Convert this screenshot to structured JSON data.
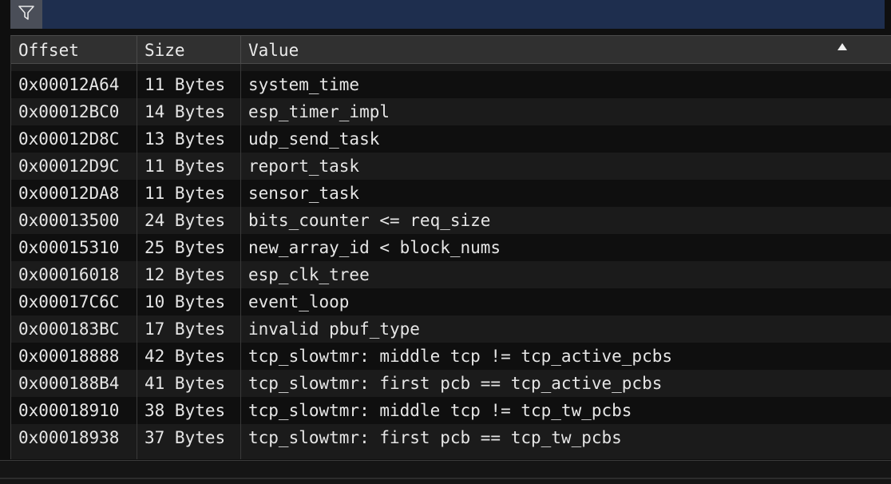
{
  "filter": {
    "icon": "filter-icon",
    "value": ""
  },
  "table": {
    "columns": [
      "Offset",
      "Size",
      "Value"
    ],
    "sort_indicator": "ascending",
    "rows": [
      {
        "offset": "0x00012A64",
        "size": "11 Bytes",
        "value": "system_time"
      },
      {
        "offset": "0x00012BC0",
        "size": "14 Bytes",
        "value": "esp_timer_impl"
      },
      {
        "offset": "0x00012D8C",
        "size": "13 Bytes",
        "value": "udp_send_task"
      },
      {
        "offset": "0x00012D9C",
        "size": "11 Bytes",
        "value": "report_task"
      },
      {
        "offset": "0x00012DA8",
        "size": "11 Bytes",
        "value": "sensor_task"
      },
      {
        "offset": "0x00013500",
        "size": "24 Bytes",
        "value": "bits_counter <= req_size"
      },
      {
        "offset": "0x00015310",
        "size": "25 Bytes",
        "value": "new_array_id < block_nums"
      },
      {
        "offset": "0x00016018",
        "size": "12 Bytes",
        "value": "esp_clk_tree"
      },
      {
        "offset": "0x00017C6C",
        "size": "10 Bytes",
        "value": "event_loop"
      },
      {
        "offset": "0x000183BC",
        "size": "17 Bytes",
        "value": "invalid pbuf_type"
      },
      {
        "offset": "0x00018888",
        "size": "42 Bytes",
        "value": "tcp_slowtmr: middle tcp != tcp_active_pcbs"
      },
      {
        "offset": "0x000188B4",
        "size": "41 Bytes",
        "value": "tcp_slowtmr: first pcb == tcp_active_pcbs"
      },
      {
        "offset": "0x00018910",
        "size": "38 Bytes",
        "value": "tcp_slowtmr: middle tcp != tcp_tw_pcbs"
      },
      {
        "offset": "0x00018938",
        "size": "37 Bytes",
        "value": "tcp_slowtmr: first pcb == tcp_tw_pcbs"
      }
    ]
  }
}
